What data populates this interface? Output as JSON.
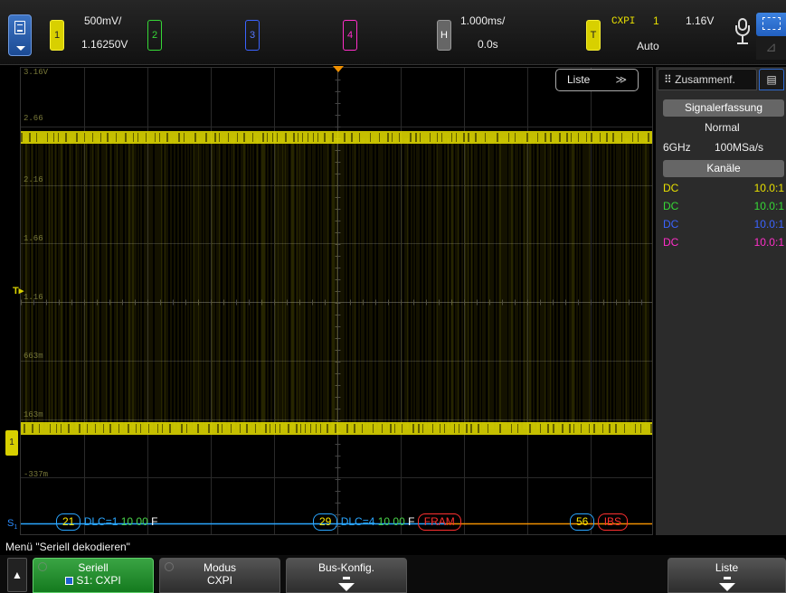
{
  "topbar": {
    "ch1": {
      "label": "1",
      "scale": "500mV/",
      "offset": "1.16250V"
    },
    "ch2": {
      "label": "2"
    },
    "ch3": {
      "label": "3"
    },
    "ch4": {
      "label": "4"
    },
    "horizontal": {
      "label": "H",
      "scale": "1.000ms/",
      "delay": "0.0s"
    },
    "trigger": {
      "label": "T",
      "source": "CXPI",
      "channel": "1",
      "level": "1.16V",
      "mode": "Auto"
    }
  },
  "grid": {
    "voltage_labels": [
      "3.16V",
      "2.66",
      "2.16",
      "1.66",
      "1.16",
      "663m",
      "163m",
      "-337m"
    ],
    "trigger_marker": "T",
    "ch1_marker": "1"
  },
  "list_dropdown": {
    "label": "Liste"
  },
  "decode": {
    "bus_label": "S",
    "bus_sub": "1",
    "frame1": {
      "id": "21",
      "info": "DLC=1",
      "data": "10 00",
      "end": "F"
    },
    "frame2": {
      "id": "29",
      "info": "DLC=4",
      "data": "10 00",
      "end": "F",
      "error": "FRAM"
    },
    "frame3": {
      "id": "56",
      "error": "IBS"
    }
  },
  "sidepanel": {
    "tab": "Zusammenf.",
    "acq_header": "Signalerfassung",
    "acq_mode": "Normal",
    "bandwidth": "6GHz",
    "sample_rate": "100MSa/s",
    "channels_header": "Kanäle",
    "channels": [
      {
        "coupling": "DC",
        "probe": "10.0:1",
        "color": "#e8e000"
      },
      {
        "coupling": "DC",
        "probe": "10.0:1",
        "color": "#36d836"
      },
      {
        "coupling": "DC",
        "probe": "10.0:1",
        "color": "#3b63ff"
      },
      {
        "coupling": "DC",
        "probe": "10.0:1",
        "color": "#ff2ec8"
      }
    ]
  },
  "message": "Menü \"Seriell dekodieren\"",
  "softkeys": {
    "seriell": {
      "label": "Seriell",
      "value": "S1: CXPI"
    },
    "modus": {
      "label": "Modus",
      "value": "CXPI"
    },
    "bus_konfig": {
      "label": "Bus-Konfig."
    },
    "liste": {
      "label": "Liste"
    }
  },
  "colors": {
    "ch1": "#e8e000",
    "ch2": "#36d836",
    "ch3": "#3b63ff",
    "ch4": "#ff2ec8",
    "bus": "#2aa6ff",
    "trigger": "#f09000"
  }
}
